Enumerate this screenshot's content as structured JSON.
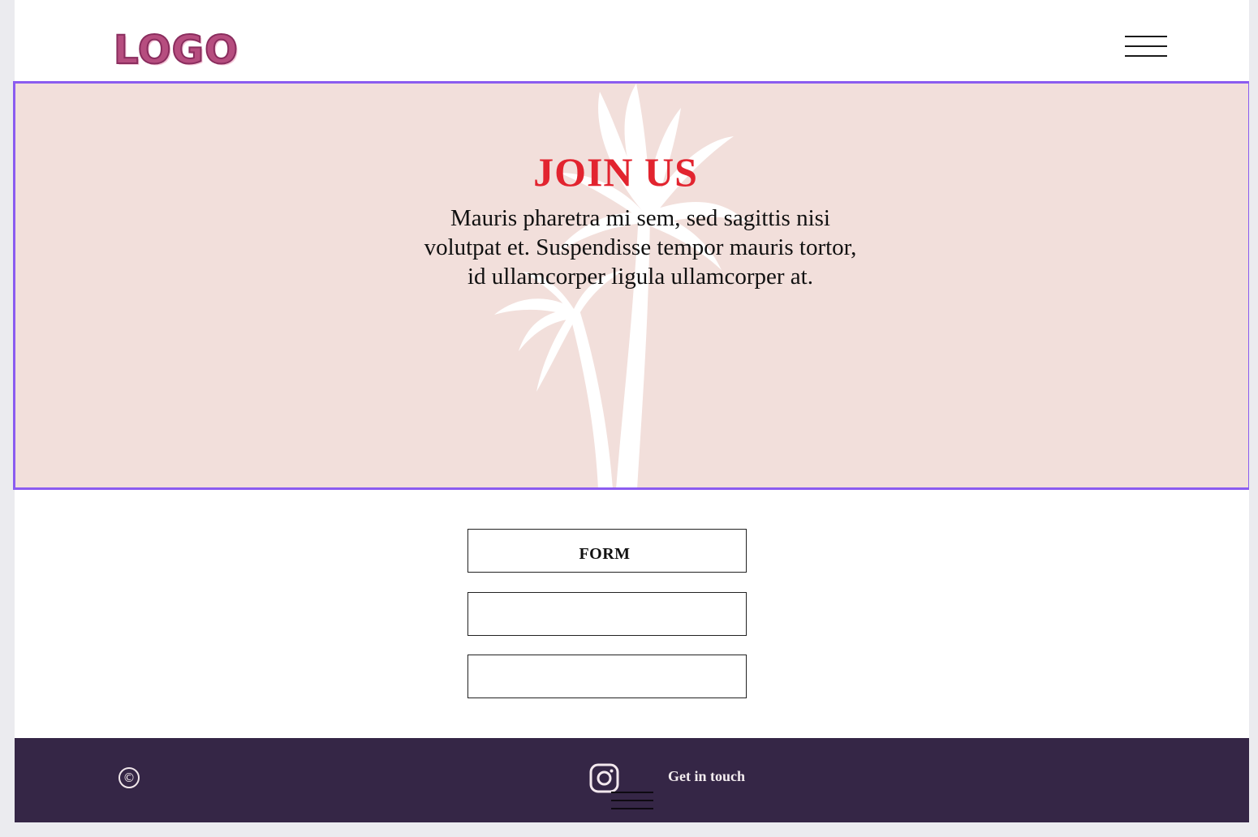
{
  "header": {
    "logo_text": "LOGO",
    "menu_icon": "hamburger-menu-icon"
  },
  "hero": {
    "title": "JOIN US",
    "description": "Mauris pharetra mi sem, sed sagittis nisi volutpat et. Suspendisse tempor mauris tortor, id ullamcorper ligula ullamcorper at.",
    "background_image": "palm-tree-icon"
  },
  "form": {
    "title": "FORM",
    "field_1_value": "",
    "field_2_value": ""
  },
  "footer": {
    "copyright_symbol": "©",
    "social_icon": "instagram-icon",
    "contact_label": "Get in touch",
    "menu_icon": "hamburger-menu-icon"
  },
  "colors": {
    "hero_bg": "#f2dfdb",
    "title_red": "#e2242f",
    "footer_bg": "#352646",
    "logo_pink": "#b64d7f",
    "selection_outline": "#8b5cf0"
  }
}
